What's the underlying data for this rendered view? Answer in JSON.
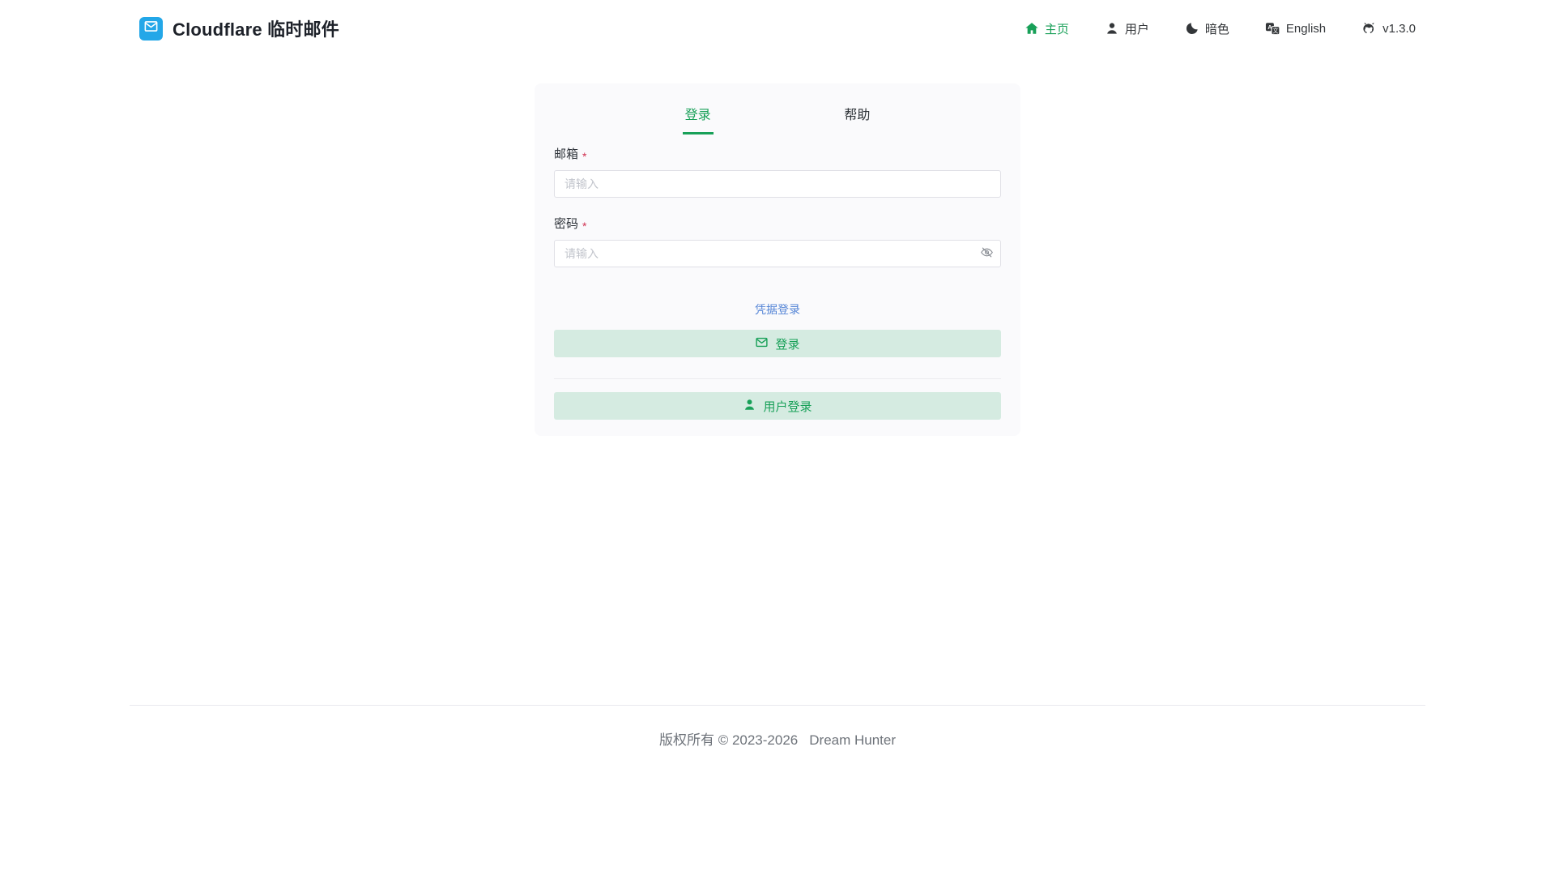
{
  "app": {
    "title": "Cloudflare 临时邮件"
  },
  "nav": {
    "home": "主页",
    "user": "用户",
    "dark": "暗色",
    "language": "English",
    "version": "v1.3.0"
  },
  "login": {
    "tab_login": "登录",
    "tab_help": "帮助",
    "email_label": "邮箱",
    "email_required": "*",
    "email_placeholder": "请输入",
    "email_value": "",
    "password_label": "密码",
    "password_required": "*",
    "password_placeholder": "请输入",
    "password_value": "",
    "credential_link": "凭据登录",
    "login_button": "登录",
    "user_login_button": "用户登录"
  },
  "footer": {
    "copyright": "版权所有 © 2023-2026",
    "author": "Dream Hunter"
  },
  "colors": {
    "primary_green": "#18a058",
    "button_green_bg": "rgba(24,160,88,0.16)",
    "logo_blue": "#23a7e8",
    "link_blue": "#5585d6",
    "required_red": "#d03050",
    "card_bg": "#fafafc"
  },
  "icons": {
    "logo": "mail-icon",
    "nav": [
      "home-icon",
      "user-icon",
      "moon-icon",
      "translate-icon",
      "github-icon"
    ],
    "password_toggle": "eye-off-icon",
    "login_button": "mail-icon",
    "user_login_button": "user-icon"
  }
}
